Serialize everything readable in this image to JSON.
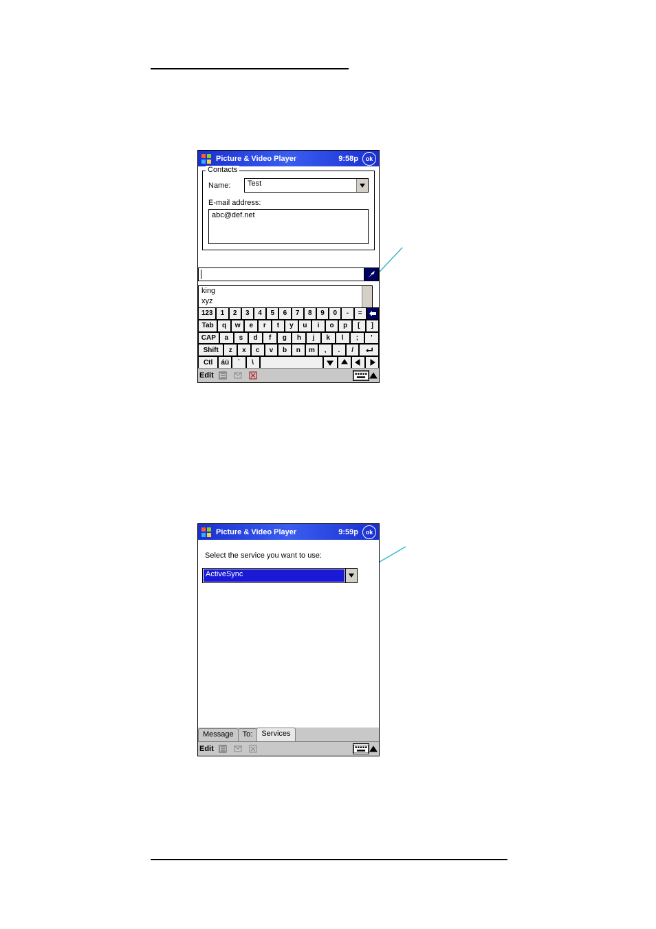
{
  "screen1": {
    "title": "Picture & Video Player",
    "time": "9:58p",
    "ok_label": "ok",
    "contacts_legend": "Contacts",
    "name_label": "Name:",
    "name_value": "Test",
    "email_label": "E-mail address:",
    "email_value": "abc@def.net",
    "suggestions": [
      "king",
      "xyz"
    ],
    "keyboard": {
      "row1": [
        "123",
        "1",
        "2",
        "3",
        "4",
        "5",
        "6",
        "7",
        "8",
        "9",
        "0",
        "-",
        "="
      ],
      "row2": [
        "Tab",
        "q",
        "w",
        "e",
        "r",
        "t",
        "y",
        "u",
        "i",
        "o",
        "p",
        "[",
        "]"
      ],
      "row3": [
        "CAP",
        "a",
        "s",
        "d",
        "f",
        "g",
        "h",
        "j",
        "k",
        "l",
        ";",
        "'"
      ],
      "row4": [
        "Shift",
        "z",
        "x",
        "c",
        "v",
        "b",
        "n",
        "m",
        ",",
        ".",
        "/"
      ],
      "row5": [
        "Ctl",
        "áü",
        "`",
        "\\"
      ]
    },
    "cmdbar_edit": "Edit"
  },
  "screen2": {
    "title": "Picture & Video Player",
    "time": "9:59p",
    "ok_label": "ok",
    "prompt": "Select the service you want to use:",
    "service_value": "ActiveSync",
    "tabs": [
      "Message",
      "To:",
      "Services"
    ],
    "cmdbar_edit": "Edit"
  }
}
